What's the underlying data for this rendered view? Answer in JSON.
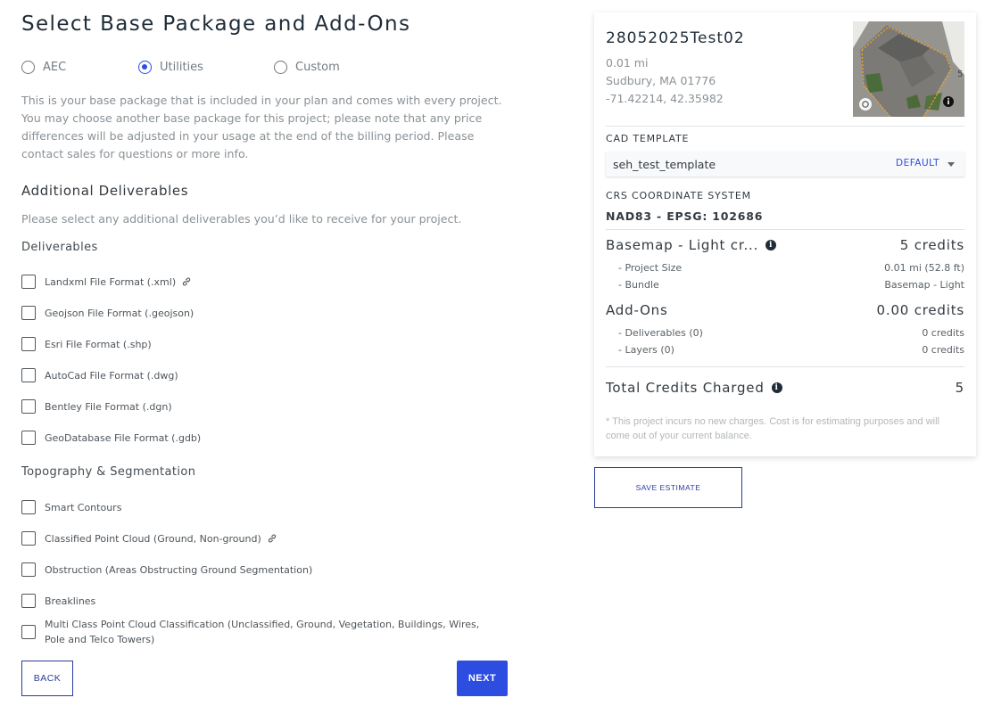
{
  "page": {
    "title": "Select Base Package and Add-Ons",
    "base_package": {
      "options": [
        {
          "label": "AEC",
          "selected": false
        },
        {
          "label": "Utilities",
          "selected": true
        },
        {
          "label": "Custom",
          "selected": false
        }
      ],
      "description": "This is your base package that is included in your plan and comes with every project. You may choose another base package for this project; please note that any price differences will be adjusted in your usage at the end of the billing period. Please contact sales for questions or more info."
    },
    "additional": {
      "heading": "Additional Deliverables",
      "instructions": "Please select any additional deliverables you’d like to receive for your project."
    },
    "deliverables": {
      "heading": "Deliverables",
      "items": [
        {
          "label": "Landxml File Format (.xml)",
          "checked": false,
          "has_link_icon": true
        },
        {
          "label": "Geojson File Format (.geojson)",
          "checked": false
        },
        {
          "label": "Esri File Format (.shp)",
          "checked": false
        },
        {
          "label": "AutoCad File Format (.dwg)",
          "checked": false
        },
        {
          "label": "Bentley File Format (.dgn)",
          "checked": false
        },
        {
          "label": "GeoDatabase File Format (.gdb)",
          "checked": false
        }
      ]
    },
    "topography": {
      "heading": "Topography & Segmentation",
      "items": [
        {
          "label": "Smart Contours",
          "checked": false
        },
        {
          "label": "Classified Point Cloud (Ground, Non-ground)",
          "checked": false,
          "has_link_icon": true
        },
        {
          "label": "Obstruction (Areas Obstructing Ground Segmentation)",
          "checked": false
        },
        {
          "label": "Breaklines",
          "checked": false
        },
        {
          "label": "Multi Class Point Cloud Classification (Unclassified, Ground, Vegetation, Buildings, Wires, Pole and Telco Towers)",
          "checked": false
        }
      ]
    },
    "buttons": {
      "back": "BACK",
      "next": "NEXT",
      "save_estimate": "SAVE ESTIMATE"
    }
  },
  "summary": {
    "project_name": "28052025Test02",
    "distance": "0.01 mi",
    "location": "Sudbury, MA 01776",
    "coordinates": "-71.42214, 42.35982",
    "map_icons": {
      "left": "layers-toggle-icon",
      "right": "info-icon"
    },
    "map_edge_text": "5",
    "cad_template": {
      "label": "CAD TEMPLATE",
      "value": "seh_test_template",
      "tag": "DEFAULT"
    },
    "crs": {
      "label": "CRS COORDINATE SYSTEM",
      "value": "NAD83 - EPSG: 102686"
    },
    "basemap": {
      "label": "Basemap - Light cr...",
      "credits": "5 credits",
      "rows": [
        {
          "label": "- Project Size",
          "value": "0.01 mi (52.8 ft)"
        },
        {
          "label": "- Bundle",
          "value": "Basemap - Light"
        }
      ]
    },
    "addons": {
      "label": "Add-Ons",
      "credits": "0.00 credits",
      "rows": [
        {
          "label": "- Deliverables (0)",
          "value": "0 credits"
        },
        {
          "label": "- Layers (0)",
          "value": "0 credits"
        }
      ]
    },
    "total": {
      "label": "Total Credits Charged",
      "value": "5"
    },
    "footnote": "* This project incurs no new charges. Cost is for estimating purposes and will come out of your current balance."
  },
  "colors": {
    "accent": "#2d4de0",
    "outline_button": "#2a3b9e",
    "parcel_outline": "#f0a020"
  }
}
